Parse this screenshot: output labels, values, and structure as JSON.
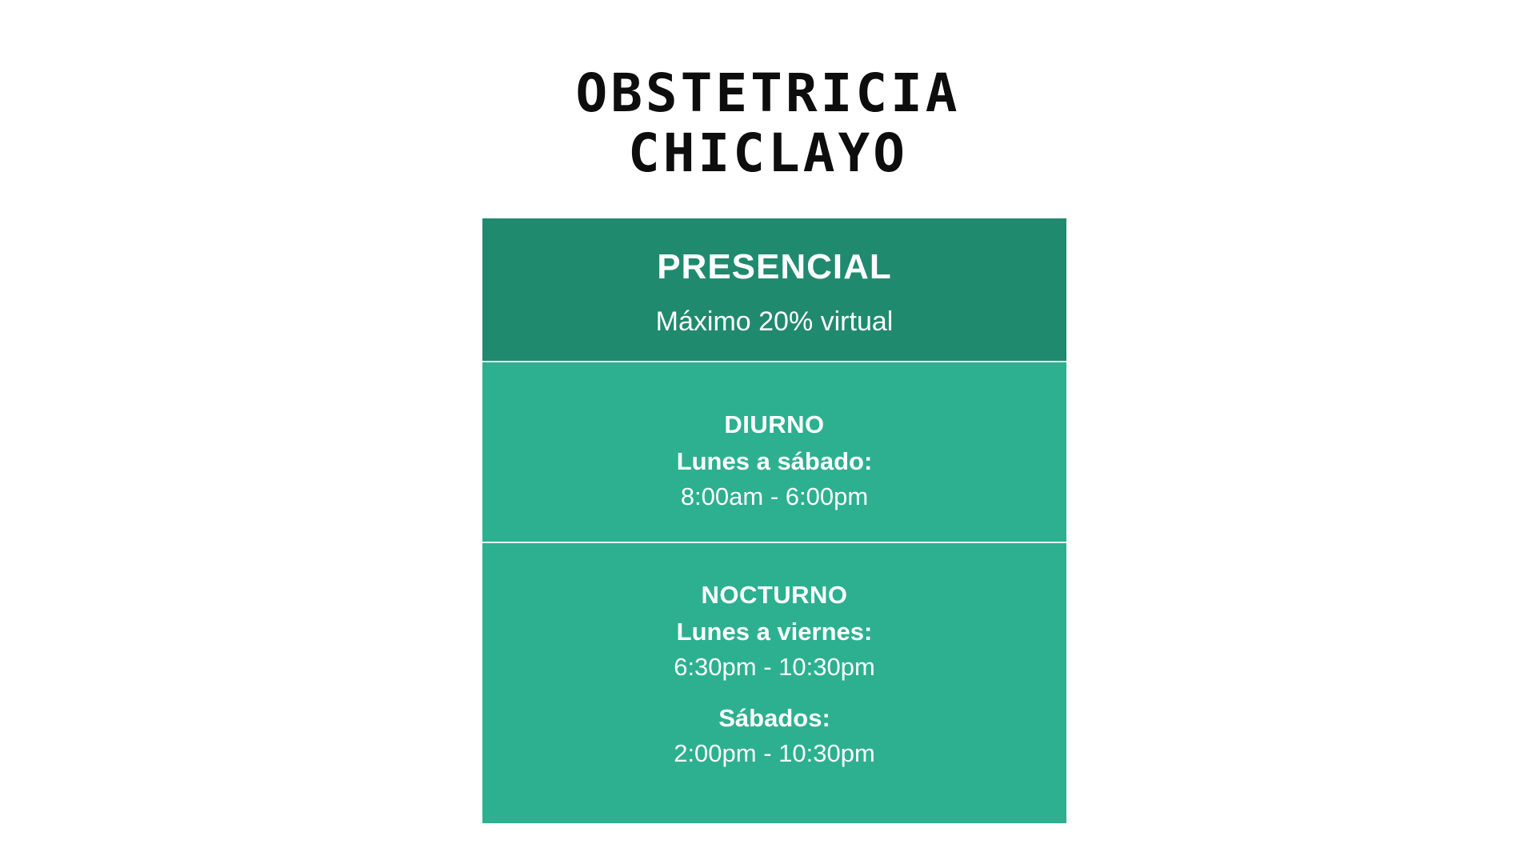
{
  "title": {
    "line1": "OBSTETRICIA",
    "line2": "CHICLAYO"
  },
  "card": {
    "header": {
      "title": "PRESENCIAL",
      "subtitle": "Máximo 20% virtual"
    },
    "diurno": {
      "title": "DIURNO",
      "days": "Lunes a sábado:",
      "time": "8:00am - 6:00pm"
    },
    "nocturno": {
      "title": "NOCTURNO",
      "weekdays": "Lunes a viernes:",
      "weekdays_time": "6:30pm - 10:30pm",
      "saturday": "Sábados:",
      "saturday_time": "2:00pm - 10:30pm"
    }
  },
  "colors": {
    "header_bg": "#208a6f",
    "body_bg": "#2cb090",
    "title_text": "#0d0d0d"
  }
}
